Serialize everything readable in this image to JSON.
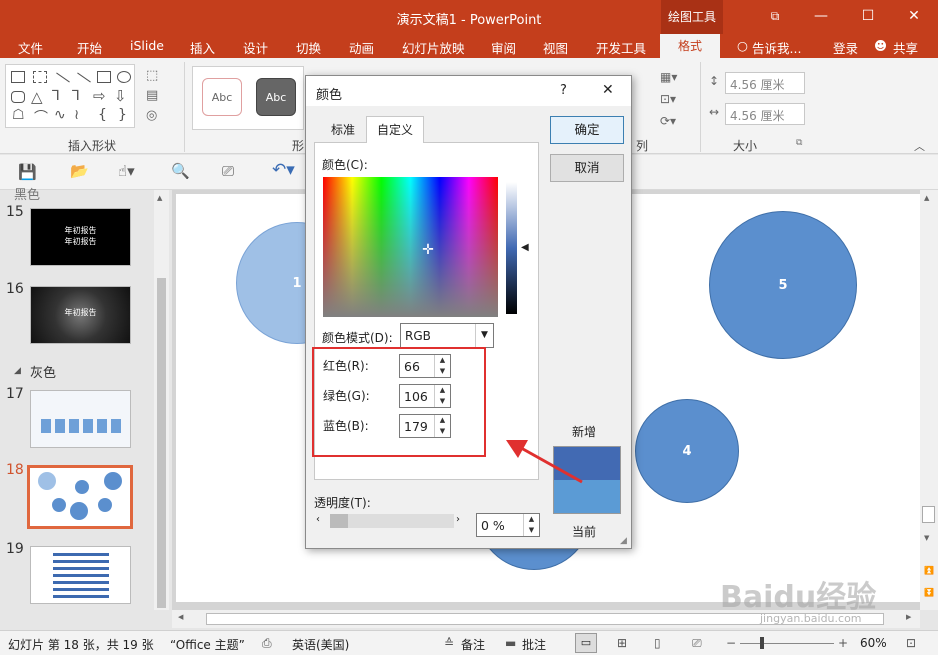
{
  "window": {
    "title": "演示文稿1 - PowerPoint",
    "context_tab_group": "绘图工具",
    "controls": {
      "restore": "⧉",
      "minimize": "—",
      "maximize": "☐",
      "close": "✕"
    }
  },
  "tabs": [
    "文件",
    "开始",
    "iSlide",
    "插入",
    "设计",
    "切换",
    "动画",
    "幻灯片放映",
    "审阅",
    "视图",
    "开发工具",
    "格式"
  ],
  "tell_me": "告诉我...",
  "login": "登录",
  "share": "共享",
  "ribbon": {
    "insert_shapes_label": "插入形状",
    "style_preview_1": "Abc",
    "style_preview_2": "Abc",
    "partial_label_1": "形",
    "partial_label_2": "列",
    "size_label": "大小",
    "height_value": "4.56 厘米",
    "width_value": "4.56 厘米"
  },
  "slides_panel": {
    "section_top": "黑色",
    "section_gray": "灰色",
    "slides": [
      {
        "num": "15",
        "title": "年初报告"
      },
      {
        "num": "16",
        "title": "年初报告"
      },
      {
        "num": "17",
        "title": ""
      },
      {
        "num": "18",
        "title": ""
      },
      {
        "num": "19",
        "title": ""
      }
    ]
  },
  "slide_canvas": {
    "circles": [
      "1",
      "5",
      "4"
    ]
  },
  "dialog": {
    "title": "颜色",
    "help": "?",
    "close": "✕",
    "tab_standard": "标准",
    "tab_custom": "自定义",
    "ok_button": "确定",
    "cancel_button": "取消",
    "colors_label": "颜色(C):",
    "color_mode_label": "颜色模式(D):",
    "color_mode_value": "RGB",
    "red_label": "红色(R):",
    "red_value": "66",
    "green_label": "绿色(G):",
    "green_value": "106",
    "blue_label": "蓝色(B):",
    "blue_value": "179",
    "new_label": "新增",
    "current_label": "当前",
    "transparency_label": "透明度(T):",
    "transparency_value": "0 %",
    "new_color": "#426ab3",
    "current_color": "#5b9bd5"
  },
  "status_bar": {
    "slide_info": "幻灯片 第 18 张，共 19 张",
    "theme": "“Office 主题”",
    "language": "英语(美国)",
    "notes": "备注",
    "comments": "批注",
    "zoom": "60%"
  },
  "watermark": {
    "brand": "Baidu经验",
    "url": "jingyan.baidu.com"
  }
}
